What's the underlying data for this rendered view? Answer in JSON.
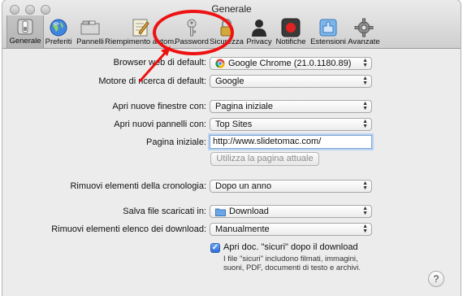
{
  "window": {
    "title": "Generale"
  },
  "toolbar": {
    "items": [
      {
        "label": "Generale",
        "icon": "general-switch-icon",
        "active": true
      },
      {
        "label": "Preferiti",
        "icon": "globe-icon"
      },
      {
        "label": "Pannelli",
        "icon": "tabs-icon"
      },
      {
        "label": "Riempimento autom.",
        "icon": "autofill-pencil-icon"
      },
      {
        "label": "Password",
        "icon": "key-icon"
      },
      {
        "label": "Sicurezza",
        "icon": "lock-icon"
      },
      {
        "label": "Privacy",
        "icon": "privacy-person-icon"
      },
      {
        "label": "Notifiche",
        "icon": "notification-record-icon"
      },
      {
        "label": "Estensioni",
        "icon": "extensions-puzzle-icon"
      },
      {
        "label": "Avanzate",
        "icon": "gear-icon"
      }
    ]
  },
  "settings": {
    "default_browser": {
      "label": "Browser web di default:",
      "value": "Google Chrome (21.0.1180.89)"
    },
    "search_engine": {
      "label": "Motore di ricerca di default:",
      "value": "Google"
    },
    "new_windows": {
      "label": "Apri nuove finestre con:",
      "value": "Pagina iniziale"
    },
    "new_tabs": {
      "label": "Apri nuovi pannelli con:",
      "value": "Top Sites"
    },
    "homepage": {
      "label": "Pagina iniziale:",
      "value": "http://www.slidetomac.com/"
    },
    "use_current_page": "Utilizza la pagina attuale",
    "remove_history": {
      "label": "Rimuovi elementi della cronologia:",
      "value": "Dopo un anno"
    },
    "save_downloads": {
      "label": "Salva file scaricati in:",
      "value": "Download"
    },
    "remove_downloads": {
      "label": "Rimuovi elementi elenco dei download:",
      "value": "Manualmente"
    },
    "open_safe": {
      "label": "Apri doc. \"sicuri\" dopo il download",
      "checked": true
    },
    "safe_note_1": "I file \"sicuri\" includono filmati, immagini,",
    "safe_note_2": "suoni, PDF, documenti di testo e archivi.",
    "help": "?"
  },
  "colors": {
    "annotation": "#ee1111",
    "accent": "#2f6fd8"
  }
}
